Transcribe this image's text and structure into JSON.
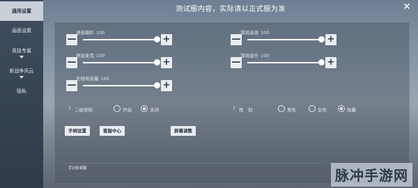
{
  "title": "测试服内容，实际请以正式服为准",
  "sidebar": {
    "items": [
      {
        "label": "通用设置",
        "active": true
      },
      {
        "label": "画面设置",
        "active": false
      },
      {
        "label": "竞技专属",
        "active": false
      },
      {
        "label": "新战争风云",
        "active": false
      },
      {
        "label": "隐私",
        "active": false
      }
    ]
  },
  "sliders": [
    {
      "label": "语音喇叭",
      "value": "100",
      "fraction": 1.0
    },
    {
      "label": "游戏音效",
      "value": "100",
      "fraction": 1.0
    },
    {
      "label": "语音麦克",
      "value": "100",
      "fraction": 1.0
    },
    {
      "label": "游戏音乐",
      "value": "100",
      "fraction": 1.0
    },
    {
      "label": "无线电音量",
      "value": "100",
      "fraction": 1.0
    }
  ],
  "buttons": {
    "minus": "—",
    "plus": "+"
  },
  "second_password": {
    "help": "?",
    "label": "二级密码",
    "options": [
      {
        "label": "开启",
        "selected": false
      },
      {
        "label": "关闭",
        "selected": true
      }
    ]
  },
  "gender": {
    "help": "?",
    "label": "性　别",
    "options": [
      {
        "label": "男性",
        "selected": false
      },
      {
        "label": "女性",
        "selected": false
      },
      {
        "label": "隐藏",
        "selected": true
      }
    ]
  },
  "actions": [
    "手柄设置",
    "客服中心",
    "屏幕调整"
  ],
  "bottom_text": "手Q安卓服",
  "watermark": "脉冲手游网",
  "close_icon": "✕"
}
